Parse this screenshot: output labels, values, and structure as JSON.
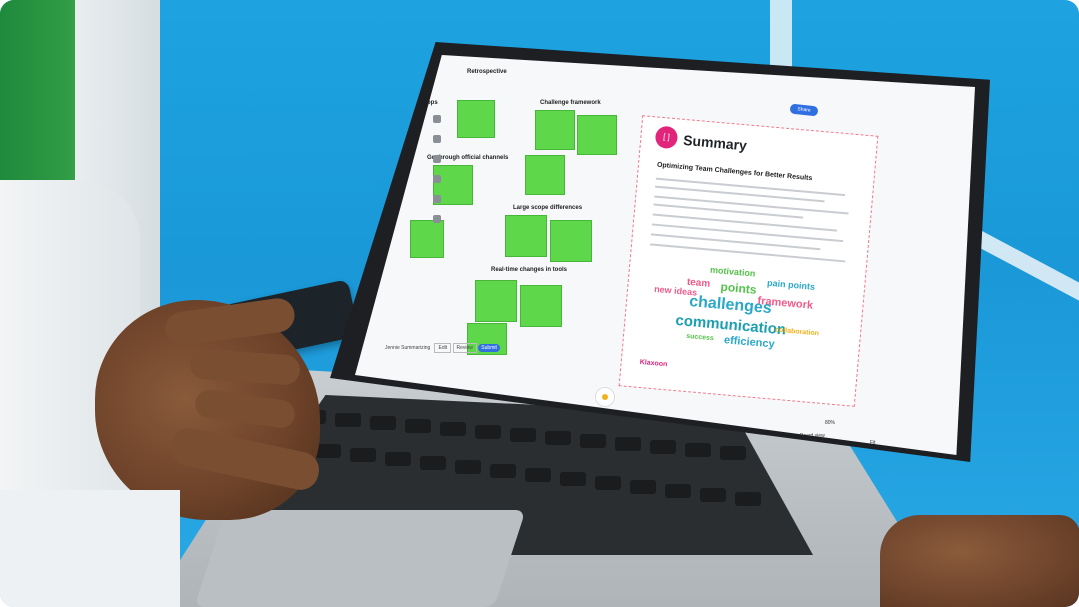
{
  "board": {
    "header_left": "Retrospective",
    "share_label": "Share",
    "sections": {
      "challenge_framework": "Challenge framework",
      "go_through": "Go through official channels",
      "large_scope": "Large scope differences",
      "real_time": "Real-time changes in tools",
      "ops": "ops"
    },
    "bottom_bar": {
      "user": "Jennie Summarizing",
      "btn1": "Edit",
      "btn2": "Review",
      "btn3": "Submit"
    },
    "zoom_footer": {
      "zoom": "80%",
      "view_label": "Board view",
      "fit": "Fit"
    }
  },
  "summary": {
    "title": "Summary",
    "subtitle": "Optimizing Team Challenges for Better Results",
    "brand": "Klaxoon",
    "words": [
      {
        "text": "motivation",
        "color": "#55c24a"
      },
      {
        "text": "pain points",
        "color": "#2aa8c8"
      },
      {
        "text": "team",
        "color": "#f25a8a"
      },
      {
        "text": "points",
        "color": "#55c24a"
      },
      {
        "text": "new ideas",
        "color": "#f25a8a"
      },
      {
        "text": "framework",
        "color": "#f25a8a"
      },
      {
        "text": "challenges",
        "color": "#2aa8c8"
      },
      {
        "text": "communication",
        "color": "#1a9fb0"
      },
      {
        "text": "efficiency",
        "color": "#2aa8c8"
      },
      {
        "text": "success",
        "color": "#55c24a"
      },
      {
        "text": "collaboration",
        "color": "#f2b21b"
      }
    ]
  },
  "colors": {
    "background_blue": "#1ea3e0",
    "sticky_green": "#5ed84a",
    "accent_pink": "#e0257a",
    "share_blue": "#2f6fe0"
  }
}
